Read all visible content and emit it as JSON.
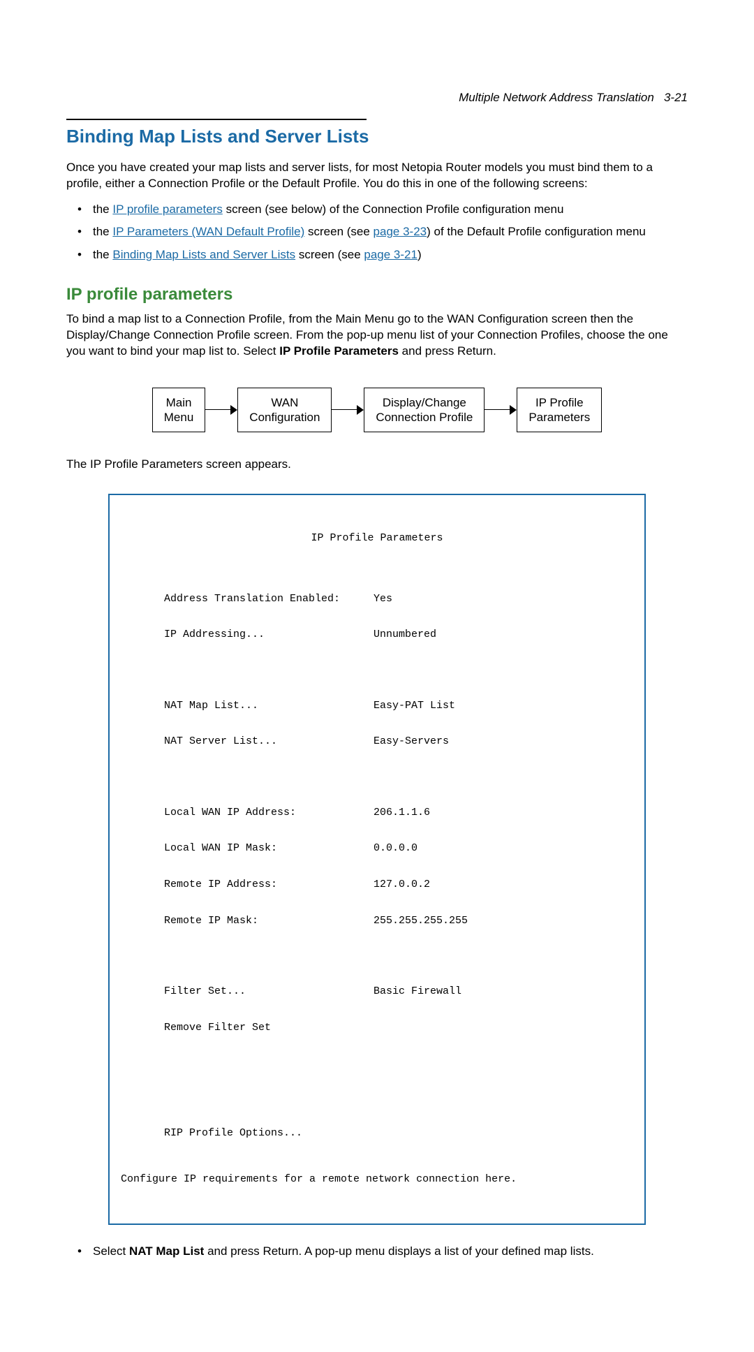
{
  "header": {
    "chapter": "Multiple Network Address Translation",
    "page_num": "3-21"
  },
  "h1": "Binding Map Lists and Server Lists",
  "intro": "Once you have created your map lists and server lists, for most Netopia Router models you must bind them to a profile, either a Connection Profile or the Default Profile. You do this in one of the following screens:",
  "bullets": [
    {
      "pre": "the ",
      "link": "IP profile parameters",
      "post": " screen (see below) of the Connection Profile configuration menu"
    },
    {
      "pre": "the ",
      "link": "IP Parameters (WAN Default Profile)",
      "mid": " screen (see ",
      "link2": "page 3-23",
      "post": ") of the Default Profile configuration menu"
    },
    {
      "pre": "the ",
      "link": "Binding Map Lists and Server Lists",
      "mid": " screen (see ",
      "link2": "page 3-21",
      "post": ")"
    }
  ],
  "h2": "IP profile parameters",
  "para2_a": "To bind a map list to a Connection Profile, from the Main Menu go to the WAN Configuration screen then the Display/Change Connection Profile screen. From the pop-up menu list of your Connection Profiles, choose the one you want to bind your map list to. Select ",
  "para2_bold": "IP Profile Parameters",
  "para2_b": " and press Return.",
  "nav": {
    "b1_l1": "Main",
    "b1_l2": "Menu",
    "b2_l1": "WAN",
    "b2_l2": "Configuration",
    "b3_l1": "Display/Change",
    "b3_l2": "Connection Profile",
    "b4_l1": "IP Profile",
    "b4_l2": "Parameters"
  },
  "after_nav": "The IP Profile Parameters screen appears.",
  "terminal": {
    "title": "IP Profile Parameters",
    "rows": [
      {
        "label": "Address Translation Enabled:",
        "value": "Yes"
      },
      {
        "label": "IP Addressing...",
        "value": "Unnumbered"
      }
    ],
    "rows2": [
      {
        "label": "NAT Map List...",
        "value": "Easy-PAT List"
      },
      {
        "label": "NAT Server List...",
        "value": "Easy-Servers"
      }
    ],
    "rows3": [
      {
        "label": "Local WAN IP Address:",
        "value": "206.1.1.6"
      },
      {
        "label": "Local WAN IP Mask:",
        "value": "0.0.0.0"
      },
      {
        "label": "Remote IP Address:",
        "value": "127.0.0.2"
      },
      {
        "label": "Remote IP Mask:",
        "value": "255.255.255.255"
      }
    ],
    "rows4": [
      {
        "label": "Filter Set...",
        "value": "Basic Firewall"
      },
      {
        "label": "Remove Filter Set",
        "value": ""
      }
    ],
    "rows5": [
      {
        "label": "RIP Profile Options...",
        "value": ""
      }
    ],
    "footer": "Configure IP requirements for a remote network connection here."
  },
  "final_bullet_a": "Select ",
  "final_bullet_bold": "NAT Map List",
  "final_bullet_b": " and press Return. A pop-up menu displays a list of your defined map lists."
}
